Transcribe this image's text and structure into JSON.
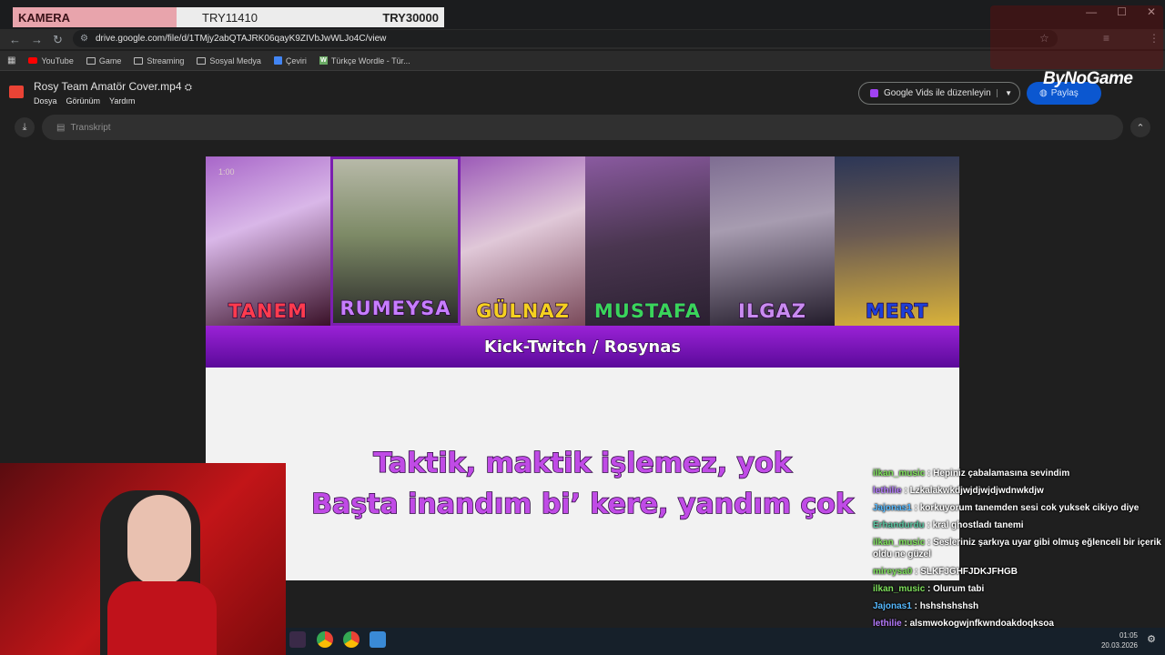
{
  "overlay": {
    "camera_label": "KAMERA",
    "goal_current": "TRY11410",
    "goal_target": "TRY30000"
  },
  "browser": {
    "url": "drive.google.com/file/d/1TMjy2abQTAJRK06qayK9ZIVbJwWLJo4C/view",
    "bookmarks": [
      "YouTube",
      "Game",
      "Streaming",
      "Sosyal Medya",
      "Çeviri",
      "Türkçe Wordle - Tür..."
    ]
  },
  "drive": {
    "file_title": "Rosy Team Amatör Cover.mp4",
    "menu": [
      "Dosya",
      "Görünüm",
      "Yardım"
    ],
    "vids_button": "Google Vids ile düzenleyin",
    "share_button": "Paylaş",
    "transcript_label": "Transkript"
  },
  "sponsor_logo": "ByNoGame",
  "video": {
    "timestamp": "1:00",
    "members": [
      {
        "name": "TANEM",
        "color": "#ff3b4e"
      },
      {
        "name": "RUMEYSA",
        "color": "#c77dff"
      },
      {
        "name": "GÜLNAZ",
        "color": "#f5d020"
      },
      {
        "name": "MUSTAFA",
        "color": "#3ad45a"
      },
      {
        "name": "ILGAZ",
        "color": "#c98bf0"
      },
      {
        "name": "MERT",
        "color": "#1e3fd8"
      }
    ],
    "channel_text": "Kick-Twitch / Rosynas",
    "lyrics": [
      "Taktik, maktik işlemez, yok",
      "Başta inandım bi’ kere, yandım çok"
    ]
  },
  "chat": [
    {
      "user": "ilkan_music",
      "user_color": "#7ee05b",
      "text": "Hepiniz çabalamasına sevindim"
    },
    {
      "user": "lethilie",
      "user_color": "#b57bff",
      "text": "Lzkalakwkdjwjdjwjdjwdnwkdjw"
    },
    {
      "user": "Jajonas1",
      "user_color": "#55b9ff",
      "text": "korkuyorum tanemden sesi cok yuksek cikiyo diye"
    },
    {
      "user": "Erhandurdu",
      "user_color": "#58c4a0",
      "text": "kral ghostladı tanemi"
    },
    {
      "user": "ilkan_music",
      "user_color": "#7ee05b",
      "text": "Sesleriniz şarkıya uyar gibi olmuş eğlenceli bir içerik oldu ne güzel"
    },
    {
      "user": "mireysa0",
      "user_color": "#7ee05b",
      "text": "SLKFJGHFJDKJFHGB"
    },
    {
      "user": "ilkan_music",
      "user_color": "#7ee05b",
      "text": "Olurum tabi"
    },
    {
      "user": "Jajonas1",
      "user_color": "#55b9ff",
      "text": "hshshshshsh"
    },
    {
      "user": "lethilie",
      "user_color": "#b57bff",
      "text": "alsmwokogwjnfkwndoakdoqksoa"
    }
  ],
  "clock": {
    "time": "01:05",
    "date": "20.03.2026"
  },
  "colors": {
    "accent": "#0b57d0",
    "video_band": "#7a14b8",
    "lyric": "#c04be6"
  }
}
